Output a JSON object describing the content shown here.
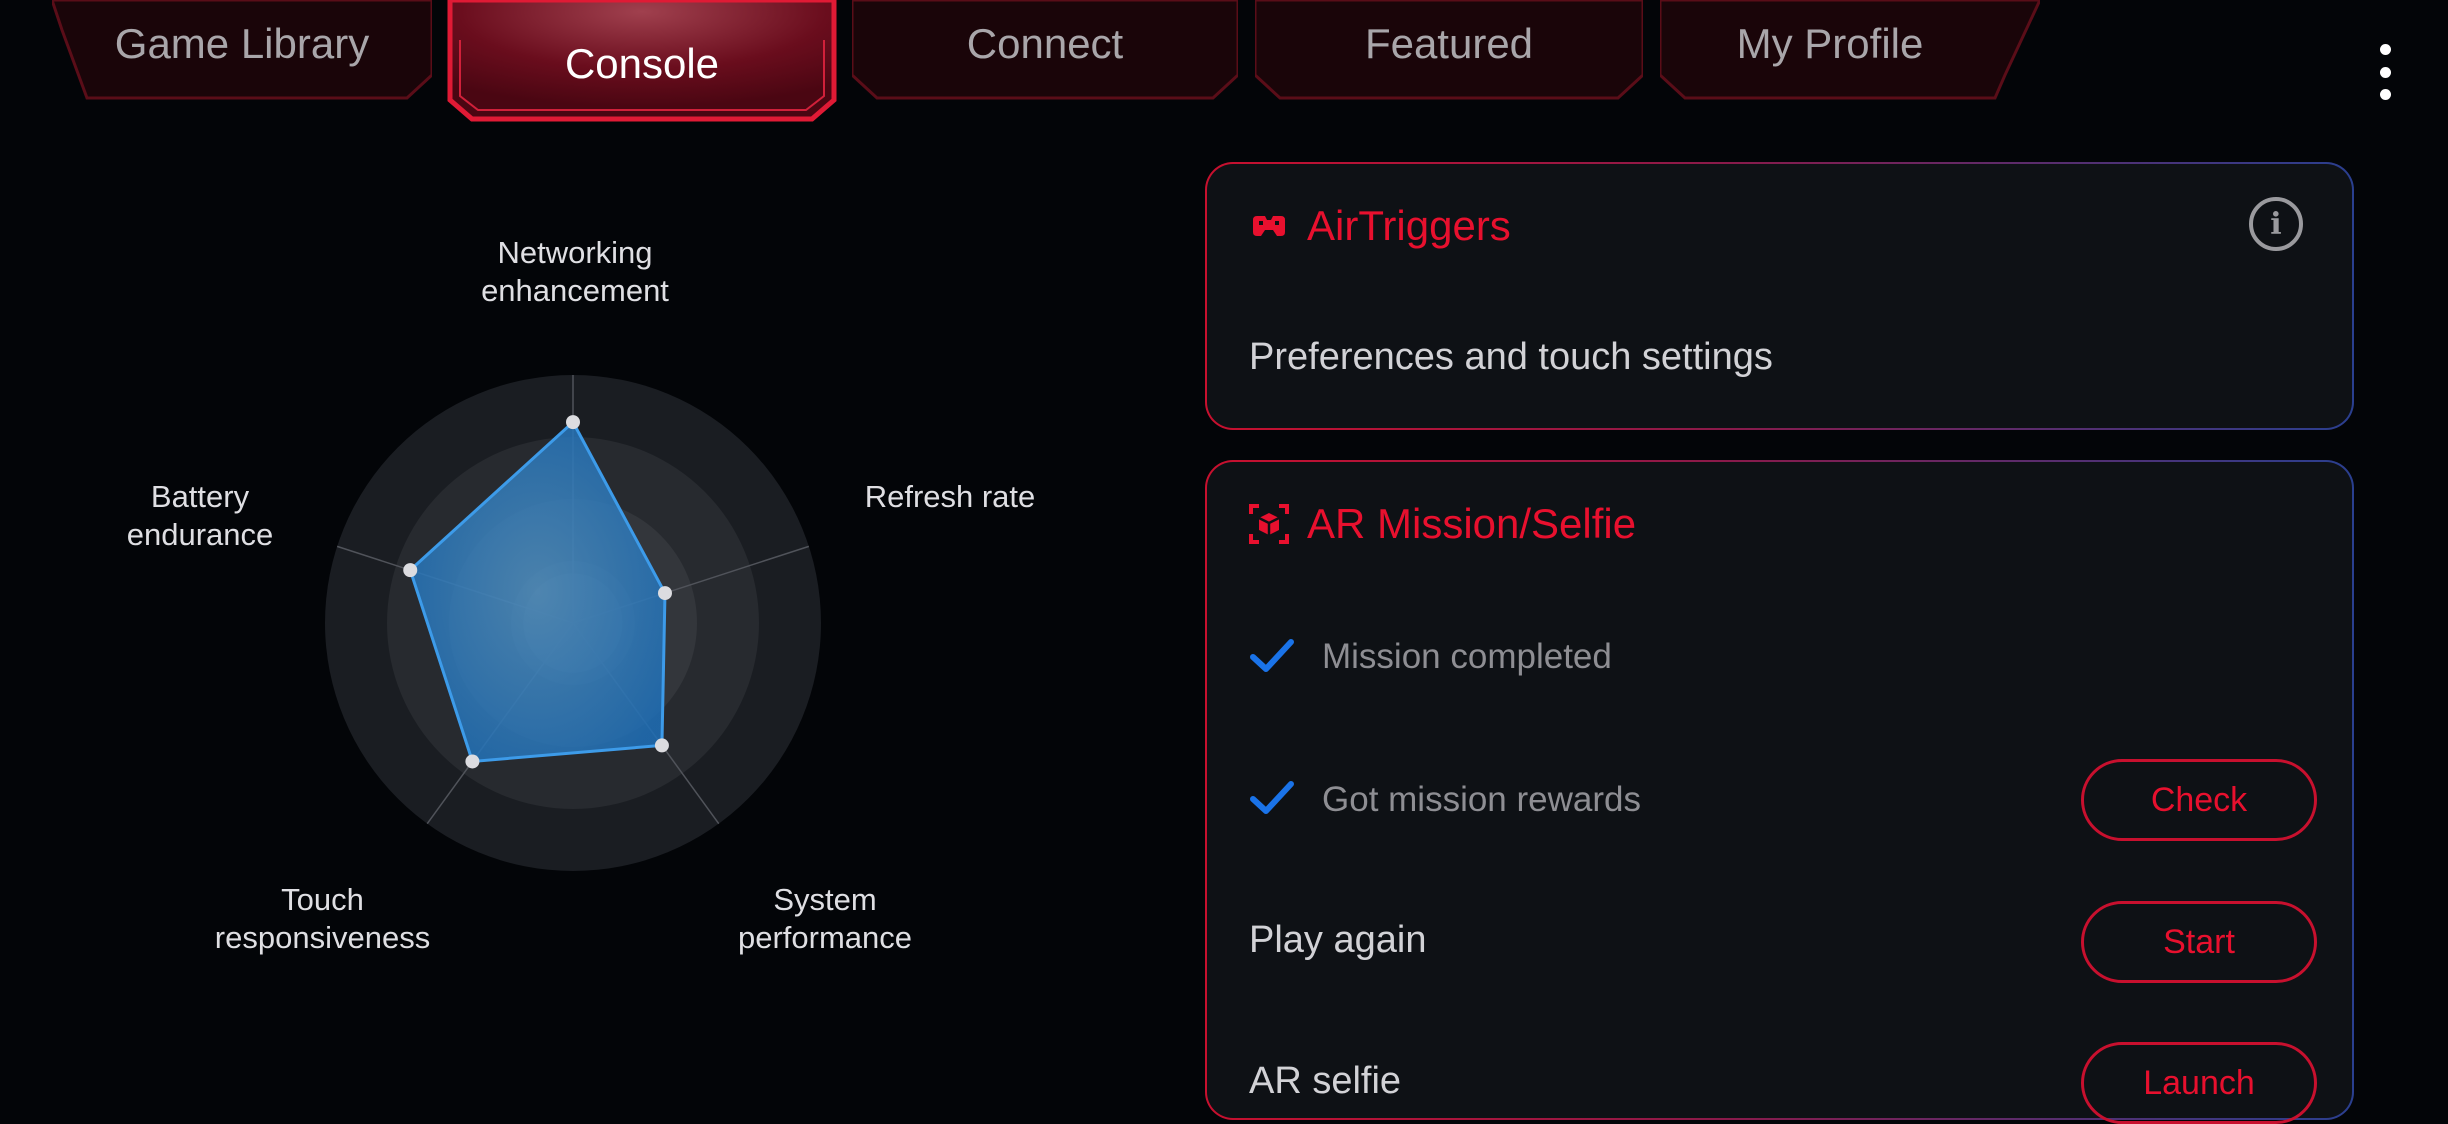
{
  "tabs": [
    {
      "label": "Game Library",
      "active": false
    },
    {
      "label": "Console",
      "active": true
    },
    {
      "label": "Connect",
      "active": false
    },
    {
      "label": "Featured",
      "active": false
    },
    {
      "label": "My Profile",
      "active": false
    }
  ],
  "menu": {
    "icon": "more-vertical-icon"
  },
  "radar": {
    "axes": [
      {
        "label": "Networking\nenhancement",
        "value": 0.81
      },
      {
        "label": "Refresh rate",
        "value": 0.39
      },
      {
        "label": "System\nperformance",
        "value": 0.61
      },
      {
        "label": "Touch\nresponsiveness",
        "value": 0.69
      },
      {
        "label": "Battery\nendurance",
        "value": 0.69
      }
    ],
    "rings": 4,
    "fill_color": "#1e6fb8",
    "line_color": "#3d9be9"
  },
  "airtriggers": {
    "title": "AirTriggers",
    "icon": "airtriggers-icon",
    "info_icon": "info-icon",
    "subtitle": "Preferences and touch settings"
  },
  "ar_mission": {
    "title": "AR Mission/Selfie",
    "icon": "ar-mission-icon",
    "rows": [
      {
        "text": "Mission completed",
        "checked": true
      },
      {
        "text": "Got mission rewards",
        "checked": true,
        "button": "Check"
      },
      {
        "text": "Play again",
        "button": "Start"
      },
      {
        "text": "AR selfie",
        "button": "Launch"
      }
    ]
  },
  "colors": {
    "accent": "#e8102e",
    "check": "#1a73e8",
    "card_bg": "#0e1115"
  }
}
